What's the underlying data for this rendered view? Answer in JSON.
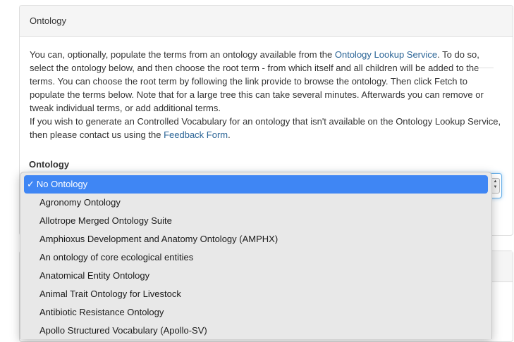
{
  "panel": {
    "heading": "Ontology",
    "intro_before_link": "You can, optionally, populate the terms from an ontology available from the ",
    "ols_link": "Ontology Lookup Service",
    "intro_after_link": ". To do so, select the ontology below, and then choose the root term - from which itself and all children will be added to the terms. You can choose the root term by following the link provide to browse the ontology. Then click Fetch to populate the terms below. Note that for a large tree this can take several minutes. Afterwards you can remove or tweak individual terms, or add additional terms.",
    "contact_before_link": "If you wish to generate an Controlled Vocabulary for an ontology that isn't available on the Ontology Lookup Service, then please contact us using the ",
    "feedback_link": "Feedback Form",
    "contact_after_link": ".",
    "field_label": "Ontology"
  },
  "select": {
    "checkmark": "✓",
    "arrow_up": "▲",
    "arrow_down": "▼",
    "selected_value": "No Ontology",
    "options": [
      "No Ontology",
      "Agronomy Ontology",
      "Allotrope Merged Ontology Suite",
      "Amphioxus Development and Anatomy Ontology (AMPHX)",
      "An ontology of core ecological entities",
      "Anatomical Entity Ontology",
      "Animal Trait Ontology for Livestock",
      "Antibiotic Resistance Ontology",
      "Apollo Structured Vocabulary (Apollo-SV)"
    ]
  },
  "colors": {
    "link": "#2a6496",
    "selected_option_bg": "#3f86f4",
    "focus_border": "#66afe9"
  }
}
